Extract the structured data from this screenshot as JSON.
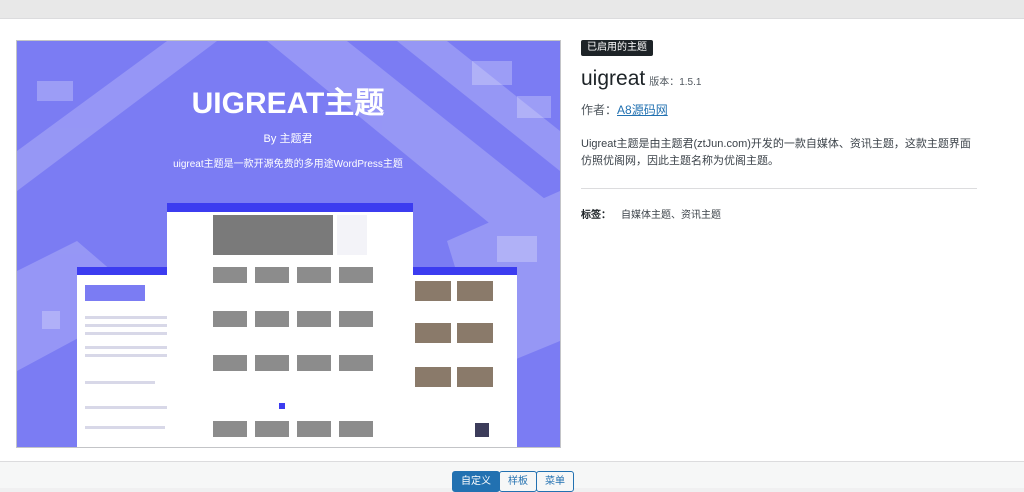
{
  "screenshot": {
    "heading": "UIGREAT主题",
    "byline": "By 主题君",
    "tagline": "uigreat主题是一款开源免费的多用途WordPress主题",
    "colors": {
      "background": "#7b7cf3",
      "accent": "#3c3cf0",
      "card": "#ffffff"
    }
  },
  "theme": {
    "active_badge": "已启用的主题",
    "name": "uigreat",
    "version_label": "版本：1.5.1",
    "author_label": "作者：",
    "author_name": "A8源码网",
    "description": "Uigreat主题是由主题君(ztJun.com)开发的一款自媒体、资讯主题，这款主题界面仿照优阁网，因此主题名称为优阁主题。",
    "tags_label": "标签：",
    "tags_value": "自媒体主题、资讯主题"
  },
  "actions": {
    "customize_label": "自定义",
    "templates_label": "样板",
    "menus_label": "菜单"
  },
  "colors": {
    "primary": "#2271b1",
    "badge_bg": "#1d2327"
  }
}
